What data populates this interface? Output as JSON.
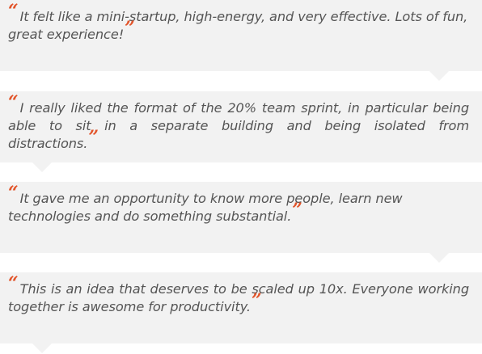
{
  "quote_marks": {
    "open": "“",
    "close": "”",
    "color": "#e2542a"
  },
  "testimonials": [
    {
      "text": "It felt like a mini-startup, high-energy, and very effective. Lots of fun, great experience!"
    },
    {
      "text": "I really liked the format of the 20% team sprint, in particular being able to sit in a separate building and being isolated from distractions."
    },
    {
      "text": "It gave me an opportunity to know more people, learn new technologies and do something substantial."
    },
    {
      "text": "This is an idea that deserves to be scaled up 10x. Everyone working together is awesome for productivity."
    }
  ]
}
